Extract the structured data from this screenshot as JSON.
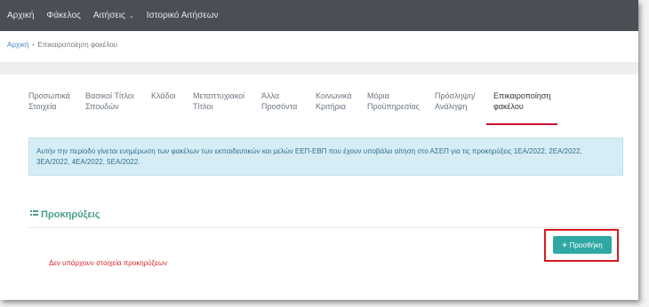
{
  "topnav": {
    "items": [
      "Αρχική",
      "Φάκελος",
      "Αιτήσεις",
      "Ιστορικό Αιτήσεων"
    ],
    "dropdown_caret": "⌄"
  },
  "breadcrumb": {
    "home": "Αρχική",
    "separator": "•",
    "current": "Επικαιροποίηση φακέλου"
  },
  "tabs": [
    {
      "line1": "Προσωπικά",
      "line2": "Στοιχεία"
    },
    {
      "line1": "Βασικοί Τίτλοι",
      "line2": "Σπουδών"
    },
    {
      "line1": "Κλάδοι",
      "line2": ""
    },
    {
      "line1": "Μεταπτυχιακοί",
      "line2": "Τίτλοι"
    },
    {
      "line1": "Άλλα",
      "line2": "Προσόντα"
    },
    {
      "line1": "Κοινωνικά",
      "line2": "Κριτήρια"
    },
    {
      "line1": "Μόρια",
      "line2": "Προϋπηρεσίας"
    },
    {
      "line1": "Πρόσληψη/",
      "line2": "Ανάληψη"
    },
    {
      "line1": "Επικαιροποίηση",
      "line2": "φακέλου"
    }
  ],
  "info": {
    "text": "Αυτήν την περίοδο γίνεται ενημέρωση των φακέλων των εκπαιδευτικών και μελών ΕΕΠ-ΕΒΠ που έχουν υποβάλει αίτηση στο ΑΣΕΠ για τις προκηρύξεις 1ΕΑ/2022, 2ΕΑ/2022, 3ΕΑ/2022, 4ΕΑ/2022, 5ΕΑ/2022."
  },
  "section": {
    "title": "Προκηρύξεις",
    "icon": "list-icon"
  },
  "add_button": {
    "plus": "+",
    "label": "Προσθήκη"
  },
  "empty_message": "Δεν υπάρχουν στοιχεία προκηρύξεων",
  "colors": {
    "nav_bg": "#4a4f55",
    "accent_teal": "#2fa8a3",
    "highlight_red": "#d71920",
    "info_bg": "#d7edf5",
    "tab_underline": "#c8102e"
  }
}
